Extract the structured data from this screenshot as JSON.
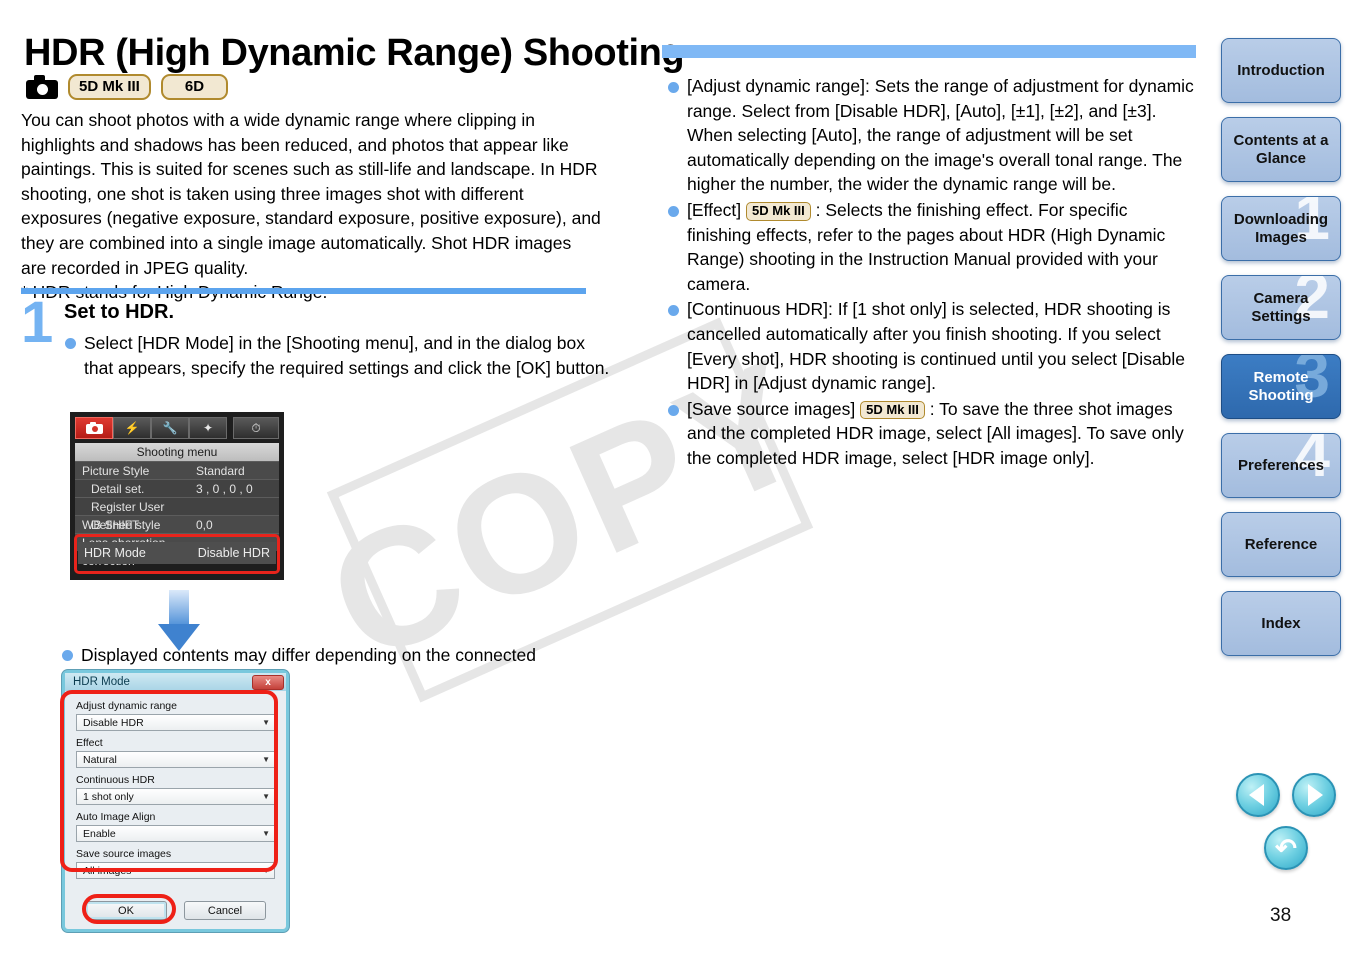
{
  "watermark": {
    "text": "COPY"
  },
  "header": {
    "title": "HDR (High Dynamic Range) Shooting",
    "camera_icon": "camera-icon",
    "badges": [
      "5D Mk III",
      "6D"
    ]
  },
  "intro": {
    "paragraph": "You can shoot photos with a wide dynamic range where clipping in highlights and shadows has been reduced, and photos that appear like paintings. This is suited for scenes such as still-life and landscape. In HDR shooting, one shot is taken using three images shot with different exposures (negative exposure, standard exposure, positive exposure), and they are combined into a single image automatically. Shot HDR images are recorded in JPEG quality.",
    "footnote": "* HDR stands for High Dynamic Range."
  },
  "step": {
    "number": "1",
    "title": "Set to HDR.",
    "bullet": "Select [HDR Mode] in the [Shooting menu], and in the dialog box that appears, specify the required settings and click the [OK] button."
  },
  "camera_menu": {
    "tabs": [
      "camera-tab-icon",
      "flash-tab-icon",
      "wrench-tab-icon",
      "star-tab-icon",
      "clock-tab-icon"
    ],
    "title": "Shooting menu",
    "rows": [
      {
        "label": "Picture Style",
        "value": "Standard"
      },
      {
        "label": "Detail set.",
        "value": "3 , 0 , 0 , 0"
      },
      {
        "label": "Register User Defined style",
        "value": ""
      },
      {
        "label": "WB SHIFT",
        "value": "0,0"
      },
      {
        "label": "Lens aberration correction",
        "value": ""
      }
    ],
    "highlighted_row": {
      "label": "HDR Mode",
      "value": "Disable HDR"
    }
  },
  "note": {
    "bullet": "Displayed contents may differ depending on the connected camera."
  },
  "dialog": {
    "title": "HDR Mode",
    "close_label": "x",
    "fields": [
      {
        "label": "Adjust dynamic range",
        "value": "Disable HDR"
      },
      {
        "label": "Effect",
        "value": "Natural"
      },
      {
        "label": "Continuous HDR",
        "value": "1 shot only"
      },
      {
        "label": "Auto Image Align",
        "value": "Enable"
      },
      {
        "label": "Save source images",
        "value": "All images"
      }
    ],
    "ok_label": "OK",
    "cancel_label": "Cancel"
  },
  "right_bullets": [
    {
      "pre": "[Adjust dynamic range]: Sets the range of adjustment for dynamic range. Select from [Disable HDR], [Auto], [±1], [±2], and [±3]. When selecting [Auto], the range of adjustment will be set automatically depending on the image's overall tonal range. The higher the number, the wider the dynamic range will be.",
      "badge": "",
      "post": ""
    },
    {
      "pre": "[Effect] ",
      "badge": "5D Mk III",
      "post": " : Selects the finishing effect. For specific finishing effects, refer to the pages about HDR (High Dynamic Range) shooting in the Instruction Manual provided with your camera."
    },
    {
      "pre": "[Continuous HDR]: If [1 shot only] is selected, HDR shooting is cancelled automatically after you finish shooting. If you select [Every shot], HDR shooting is continued until you select [Disable HDR] in [Adjust dynamic range].",
      "badge": "",
      "post": ""
    },
    {
      "pre": "[Save source images] ",
      "badge": "5D Mk III",
      "post": " : To save the three shot images and the completed HDR image, select [All images]. To save only the completed HDR image, select [HDR image only]."
    }
  ],
  "sidebar": {
    "items": [
      {
        "label": "Introduction",
        "ghost": "",
        "active": false
      },
      {
        "label": "Contents at a Glance",
        "ghost": "",
        "active": false
      },
      {
        "label": "Downloading Images",
        "ghost": "1",
        "active": false
      },
      {
        "label": "Camera Settings",
        "ghost": "2",
        "active": false
      },
      {
        "label": "Remote Shooting",
        "ghost": "3",
        "active": true
      },
      {
        "label": "Preferences",
        "ghost": "4",
        "active": false
      },
      {
        "label": "Reference",
        "ghost": "",
        "active": false
      },
      {
        "label": "Index",
        "ghost": "",
        "active": false
      }
    ]
  },
  "nav": {
    "prev": "prev-arrow-icon",
    "next": "next-arrow-icon",
    "back": "return-arrow-icon"
  },
  "page_number": "38",
  "colors": {
    "rule_blue": "#7fb8f5",
    "step_rule_blue": "#5ca4ee",
    "bullet_blue": "#6aa9ec",
    "badge_border": "#b08a2e",
    "badge_fill": "#f2e8d2",
    "highlight_red": "#ee2017",
    "nav_active": "#2e69ad"
  }
}
